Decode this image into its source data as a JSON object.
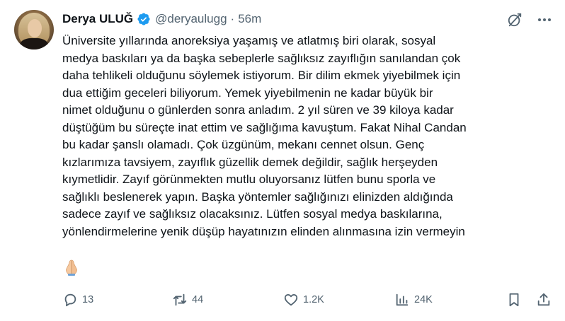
{
  "tweet": {
    "author_name": "Derya ULUĞ",
    "handle": "@deryaulugg",
    "separator": "·",
    "time": "56m",
    "lines": [
      "Üniversite yıllarında anoreksiya yaşamış ve atlatmış biri olarak, sosyal",
      "medya baskıları ya da başka sebeplerle sağlıksız zayıflığın sanılandan çok",
      "daha tehlikeli olduğunu söylemek istiyorum. Bir dilim ekmek yiyebilmek için",
      "dua ettiğim geceleri biliyorum. Yemek yiyebilmenin ne kadar büyük bir",
      "nimet olduğunu o günlerden sonra anladım. 2 yıl süren ve 39 kiloya kadar",
      "düştüğüm bu süreçte inat ettim ve sağlığıma kavuştum. Fakat Nihal Candan",
      "bu kadar şanslı olamadı. Çok üzgünüm, mekanı cennet olsun. Genç",
      "kızlarımıza tavsiyem, zayıflık güzellik demek değildir, sağlık herşeyden",
      "kıymetlidir. Zayıf görünmekten mutlu oluyorsanız lütfen bunu sporla ve",
      "sağlıklı beslenerek yapın. Başka yöntemler sağlığınızı elinizden aldığında",
      "sadece zayıf ve sağlıksız olacaksınız. Lütfen sosyal medya baskılarına,",
      "yönlendirmelerine yenik düşüp hayatınızın elinden alınmasına izin vermeyin"
    ],
    "emoji": "praying-hands-emoji"
  },
  "actions": {
    "replies": "13",
    "reposts": "44",
    "likes": "1.2K",
    "views": "24K"
  },
  "icons": [
    "verified-badge-icon",
    "grok-icon",
    "more-icon",
    "reply-icon",
    "repost-icon",
    "like-icon",
    "views-icon",
    "bookmark-icon",
    "share-icon"
  ],
  "colors": {
    "verified": "#1d9bf0",
    "text": "#0f1419",
    "secondary": "#536471"
  }
}
